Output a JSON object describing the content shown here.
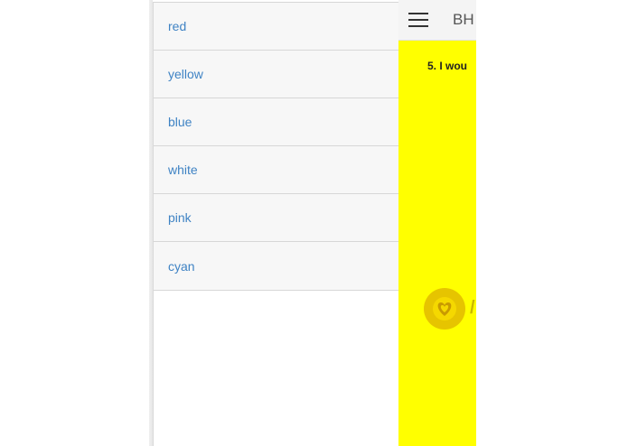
{
  "drawer": {
    "items": [
      {
        "label": "red"
      },
      {
        "label": "yellow"
      },
      {
        "label": "blue"
      },
      {
        "label": "white"
      },
      {
        "label": "pink"
      },
      {
        "label": "cyan"
      }
    ]
  },
  "app": {
    "title": "BH",
    "question": "5. I wou",
    "heart_text": "/",
    "background_color": "#ffff00"
  }
}
